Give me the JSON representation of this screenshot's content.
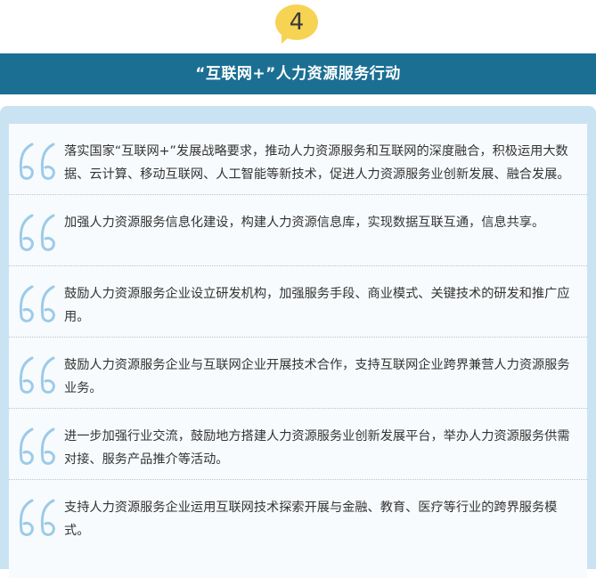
{
  "badge": {
    "number": "4"
  },
  "header": {
    "title": "“互联网+”人力资源服务行动"
  },
  "items": [
    {
      "text": "落实国家“互联网+”发展战略要求，推动人力资源服务和互联网的深度融合，积极运用大数据、云计算、移动互联网、人工智能等新技术，促进人力资源服务业创新发展、融合发展。"
    },
    {
      "text": "加强人力资源服务信息化建设，构建人力资源信息库，实现数据互联互通，信息共享。"
    },
    {
      "text": "鼓励人力资源服务企业设立研发机构，加强服务手段、商业模式、关键技术的研发和推广应用。"
    },
    {
      "text": "鼓励人力资源服务企业与互联网企业开展技术合作，支持互联网企业跨界兼营人力资源服务业务。"
    },
    {
      "text": "进一步加强行业交流，鼓励地方搭建人力资源服务业创新发展平台，举办人力资源服务供需对接、服务产品推介等活动。"
    },
    {
      "text": "支持人力资源服务企业运用互联网技术探索开展与金融、教育、医疗等行业的跨界服务模式。"
    }
  ],
  "colors": {
    "title_bar": "#1b6f93",
    "badge": "#f7d354",
    "panel": "#c9e3f3",
    "quote_mark": "#9ccbe8"
  },
  "icons": {
    "quote": "open-quote-icon"
  }
}
